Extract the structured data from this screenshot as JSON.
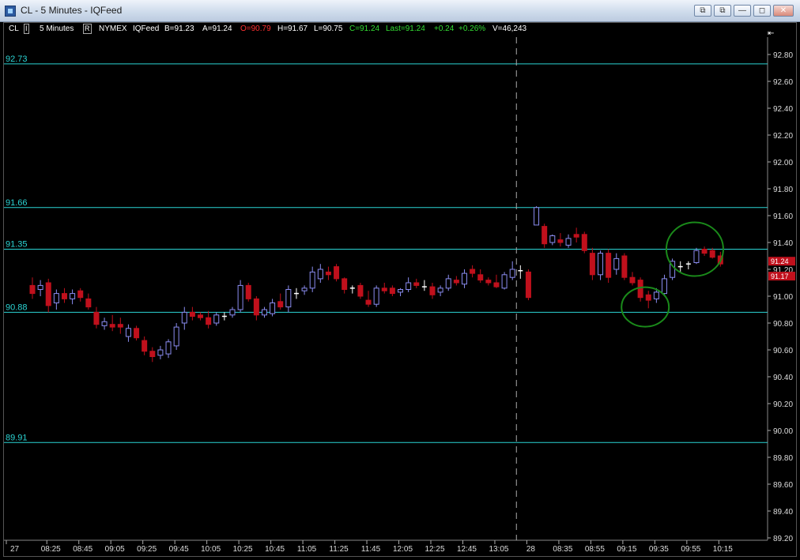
{
  "window": {
    "title": "CL - 5 Minutes - IQFeed",
    "buttons": [
      "⧉",
      "⧉",
      "—",
      "◻",
      "✕"
    ]
  },
  "infobar": {
    "symbol": "CL",
    "symbol_dd": "I",
    "interval": "5 Minutes",
    "interval_dd": "R",
    "exchange": "NYMEX",
    "feed": "IQFeed",
    "bid": "B=91.23",
    "ask": "A=91.24",
    "open": "O=90.79",
    "high": "H=91.67",
    "low": "L=90.75",
    "close": "C=91.24",
    "last": "Last=91.24",
    "change": "+0.24",
    "change_pct": "+0.26%",
    "volume": "V=46,243"
  },
  "axis_menu_glyph": "⇤",
  "colors": {
    "up": "#8a8cf0",
    "down": "#c0101c",
    "doji": "#ffffff",
    "hline": "#2bd4d4",
    "grid_label": "#dddddd",
    "open_red": "#ff3030",
    "green": "#33dd33",
    "circle": "#1a8a1a"
  },
  "chart_data": {
    "type": "candlestick",
    "price_axis": {
      "ylim": [
        89.2,
        92.9
      ],
      "ticks": [
        "92.80",
        "92.60",
        "92.40",
        "92.20",
        "92.00",
        "91.80",
        "91.60",
        "91.40",
        "91.20",
        "91.00",
        "90.80",
        "90.60",
        "90.40",
        "90.20",
        "90.00",
        "89.80",
        "89.60",
        "89.40",
        "89.20"
      ]
    },
    "time_axis": {
      "labels": [
        "27",
        "08:25",
        "08:45",
        "09:05",
        "09:25",
        "09:45",
        "10:05",
        "10:25",
        "10:45",
        "11:05",
        "11:25",
        "11:45",
        "12:05",
        "12:25",
        "12:45",
        "13:05",
        "28",
        "08:35",
        "08:55",
        "09:15",
        "09:35",
        "09:55",
        "10:15"
      ],
      "label_bar_index": [
        0,
        2,
        6,
        10,
        14,
        18,
        22,
        26,
        30,
        34,
        38,
        42,
        46,
        50,
        54,
        58,
        62,
        66,
        70,
        74,
        78,
        82,
        86
      ]
    },
    "horizontal_lines": [
      {
        "price": 92.73,
        "label": "92.73"
      },
      {
        "price": 91.66,
        "label": "91.66"
      },
      {
        "price": 91.35,
        "label": "91.35"
      },
      {
        "price": 90.88,
        "label": "90.88"
      },
      {
        "price": 89.91,
        "label": "89.91"
      }
    ],
    "price_tags": [
      {
        "price": 91.24,
        "label": "91.24"
      },
      {
        "price": 91.17,
        "label": "91.17"
      }
    ],
    "session_break_bar": 60.5,
    "bars": [
      {
        "o": 91.08,
        "h": 91.14,
        "l": 90.98,
        "c": 91.02
      },
      {
        "o": 91.05,
        "h": 91.12,
        "l": 91.0,
        "c": 91.08
      },
      {
        "o": 91.1,
        "h": 91.13,
        "l": 90.88,
        "c": 90.93
      },
      {
        "o": 90.95,
        "h": 91.05,
        "l": 90.9,
        "c": 91.02
      },
      {
        "o": 91.02,
        "h": 91.06,
        "l": 90.95,
        "c": 90.98
      },
      {
        "o": 90.98,
        "h": 91.05,
        "l": 90.94,
        "c": 91.02
      },
      {
        "o": 91.04,
        "h": 91.06,
        "l": 90.96,
        "c": 90.99
      },
      {
        "o": 90.98,
        "h": 91.02,
        "l": 90.9,
        "c": 90.92
      },
      {
        "o": 90.88,
        "h": 90.92,
        "l": 90.76,
        "c": 90.79
      },
      {
        "o": 90.78,
        "h": 90.84,
        "l": 90.75,
        "c": 90.81
      },
      {
        "o": 90.79,
        "h": 90.86,
        "l": 90.74,
        "c": 90.77
      },
      {
        "o": 90.79,
        "h": 90.84,
        "l": 90.72,
        "c": 90.77
      },
      {
        "o": 90.7,
        "h": 90.79,
        "l": 90.66,
        "c": 90.76
      },
      {
        "o": 90.76,
        "h": 90.78,
        "l": 90.67,
        "c": 90.69
      },
      {
        "o": 90.67,
        "h": 90.7,
        "l": 90.56,
        "c": 90.59
      },
      {
        "o": 90.59,
        "h": 90.62,
        "l": 90.51,
        "c": 90.55
      },
      {
        "o": 90.56,
        "h": 90.63,
        "l": 90.53,
        "c": 90.6
      },
      {
        "o": 90.57,
        "h": 90.68,
        "l": 90.54,
        "c": 90.66
      },
      {
        "o": 90.63,
        "h": 90.8,
        "l": 90.6,
        "c": 90.77
      },
      {
        "o": 90.8,
        "h": 90.92,
        "l": 90.75,
        "c": 90.88
      },
      {
        "o": 90.88,
        "h": 90.92,
        "l": 90.82,
        "c": 90.85
      },
      {
        "o": 90.86,
        "h": 90.88,
        "l": 90.82,
        "c": 90.84
      },
      {
        "o": 90.84,
        "h": 90.89,
        "l": 90.76,
        "c": 90.79
      },
      {
        "o": 90.8,
        "h": 90.88,
        "l": 90.78,
        "c": 90.86
      },
      {
        "o": 90.86,
        "h": 90.88,
        "l": 90.82,
        "c": 90.85
      },
      {
        "o": 90.86,
        "h": 90.92,
        "l": 90.84,
        "c": 90.9
      },
      {
        "o": 90.9,
        "h": 91.12,
        "l": 90.88,
        "c": 91.08
      },
      {
        "o": 91.08,
        "h": 91.1,
        "l": 90.96,
        "c": 90.98
      },
      {
        "o": 90.98,
        "h": 91.0,
        "l": 90.82,
        "c": 90.86
      },
      {
        "o": 90.86,
        "h": 90.92,
        "l": 90.84,
        "c": 90.9
      },
      {
        "o": 90.87,
        "h": 90.98,
        "l": 90.85,
        "c": 90.95
      },
      {
        "o": 90.96,
        "h": 91.02,
        "l": 90.9,
        "c": 90.92
      },
      {
        "o": 90.92,
        "h": 91.08,
        "l": 90.88,
        "c": 91.05
      },
      {
        "o": 91.02,
        "h": 91.06,
        "l": 90.98,
        "c": 91.02
      },
      {
        "o": 91.04,
        "h": 91.08,
        "l": 91.01,
        "c": 91.06
      },
      {
        "o": 91.06,
        "h": 91.22,
        "l": 91.03,
        "c": 91.18
      },
      {
        "o": 91.13,
        "h": 91.24,
        "l": 91.1,
        "c": 91.2
      },
      {
        "o": 91.18,
        "h": 91.22,
        "l": 91.12,
        "c": 91.16
      },
      {
        "o": 91.22,
        "h": 91.24,
        "l": 91.11,
        "c": 91.13
      },
      {
        "o": 91.13,
        "h": 91.14,
        "l": 91.02,
        "c": 91.05
      },
      {
        "o": 91.06,
        "h": 91.08,
        "l": 91.02,
        "c": 91.06
      },
      {
        "o": 91.08,
        "h": 91.1,
        "l": 90.98,
        "c": 91.0
      },
      {
        "o": 90.97,
        "h": 91.04,
        "l": 90.92,
        "c": 90.94
      },
      {
        "o": 90.94,
        "h": 91.08,
        "l": 90.92,
        "c": 91.06
      },
      {
        "o": 91.06,
        "h": 91.1,
        "l": 91.02,
        "c": 91.04
      },
      {
        "o": 91.06,
        "h": 91.08,
        "l": 91.0,
        "c": 91.02
      },
      {
        "o": 91.03,
        "h": 91.06,
        "l": 91.0,
        "c": 91.05
      },
      {
        "o": 91.05,
        "h": 91.14,
        "l": 91.03,
        "c": 91.1
      },
      {
        "o": 91.1,
        "h": 91.13,
        "l": 91.06,
        "c": 91.08
      },
      {
        "o": 91.08,
        "h": 91.12,
        "l": 91.04,
        "c": 91.07
      },
      {
        "o": 91.07,
        "h": 91.1,
        "l": 90.98,
        "c": 91.01
      },
      {
        "o": 91.03,
        "h": 91.08,
        "l": 91.0,
        "c": 91.06
      },
      {
        "o": 91.06,
        "h": 91.16,
        "l": 91.04,
        "c": 91.13
      },
      {
        "o": 91.12,
        "h": 91.15,
        "l": 91.08,
        "c": 91.1
      },
      {
        "o": 91.09,
        "h": 91.2,
        "l": 91.06,
        "c": 91.17
      },
      {
        "o": 91.2,
        "h": 91.23,
        "l": 91.14,
        "c": 91.17
      },
      {
        "o": 91.16,
        "h": 91.2,
        "l": 91.1,
        "c": 91.12
      },
      {
        "o": 91.12,
        "h": 91.14,
        "l": 91.08,
        "c": 91.1
      },
      {
        "o": 91.1,
        "h": 91.16,
        "l": 91.06,
        "c": 91.07
      },
      {
        "o": 91.06,
        "h": 91.18,
        "l": 91.05,
        "c": 91.16
      },
      {
        "o": 91.14,
        "h": 91.26,
        "l": 91.12,
        "c": 91.2
      },
      {
        "o": 91.19,
        "h": 91.23,
        "l": 91.13,
        "c": 91.19
      },
      {
        "o": 91.18,
        "h": 91.2,
        "l": 90.97,
        "c": 90.99
      },
      {
        "o": 91.53,
        "h": 91.67,
        "l": 91.53,
        "c": 91.66
      },
      {
        "o": 91.52,
        "h": 91.54,
        "l": 91.36,
        "c": 91.39
      },
      {
        "o": 91.4,
        "h": 91.46,
        "l": 91.38,
        "c": 91.45
      },
      {
        "o": 91.42,
        "h": 91.47,
        "l": 91.37,
        "c": 91.4
      },
      {
        "o": 91.38,
        "h": 91.46,
        "l": 91.36,
        "c": 91.43
      },
      {
        "o": 91.46,
        "h": 91.51,
        "l": 91.4,
        "c": 91.44
      },
      {
        "o": 91.46,
        "h": 91.48,
        "l": 91.32,
        "c": 91.34
      },
      {
        "o": 91.32,
        "h": 91.36,
        "l": 91.12,
        "c": 91.16
      },
      {
        "o": 91.16,
        "h": 91.34,
        "l": 91.12,
        "c": 91.32
      },
      {
        "o": 91.32,
        "h": 91.35,
        "l": 91.1,
        "c": 91.14
      },
      {
        "o": 91.2,
        "h": 91.32,
        "l": 91.16,
        "c": 91.28
      },
      {
        "o": 91.3,
        "h": 91.32,
        "l": 91.12,
        "c": 91.14
      },
      {
        "o": 91.14,
        "h": 91.18,
        "l": 91.08,
        "c": 91.1
      },
      {
        "o": 91.12,
        "h": 91.14,
        "l": 90.96,
        "c": 90.99
      },
      {
        "o": 91.01,
        "h": 91.04,
        "l": 90.91,
        "c": 90.97
      },
      {
        "o": 90.98,
        "h": 91.06,
        "l": 90.95,
        "c": 91.03
      },
      {
        "o": 91.02,
        "h": 91.16,
        "l": 91.0,
        "c": 91.13
      },
      {
        "o": 91.14,
        "h": 91.28,
        "l": 91.12,
        "c": 91.26
      },
      {
        "o": 91.21,
        "h": 91.26,
        "l": 91.18,
        "c": 91.22
      },
      {
        "o": 91.24,
        "h": 91.26,
        "l": 91.2,
        "c": 91.24
      },
      {
        "o": 91.25,
        "h": 91.36,
        "l": 91.24,
        "c": 91.34
      },
      {
        "o": 91.35,
        "h": 91.37,
        "l": 91.3,
        "c": 91.32
      },
      {
        "o": 91.34,
        "h": 91.36,
        "l": 91.28,
        "c": 91.29
      },
      {
        "o": 91.3,
        "h": 91.33,
        "l": 91.22,
        "c": 91.24
      }
    ]
  }
}
